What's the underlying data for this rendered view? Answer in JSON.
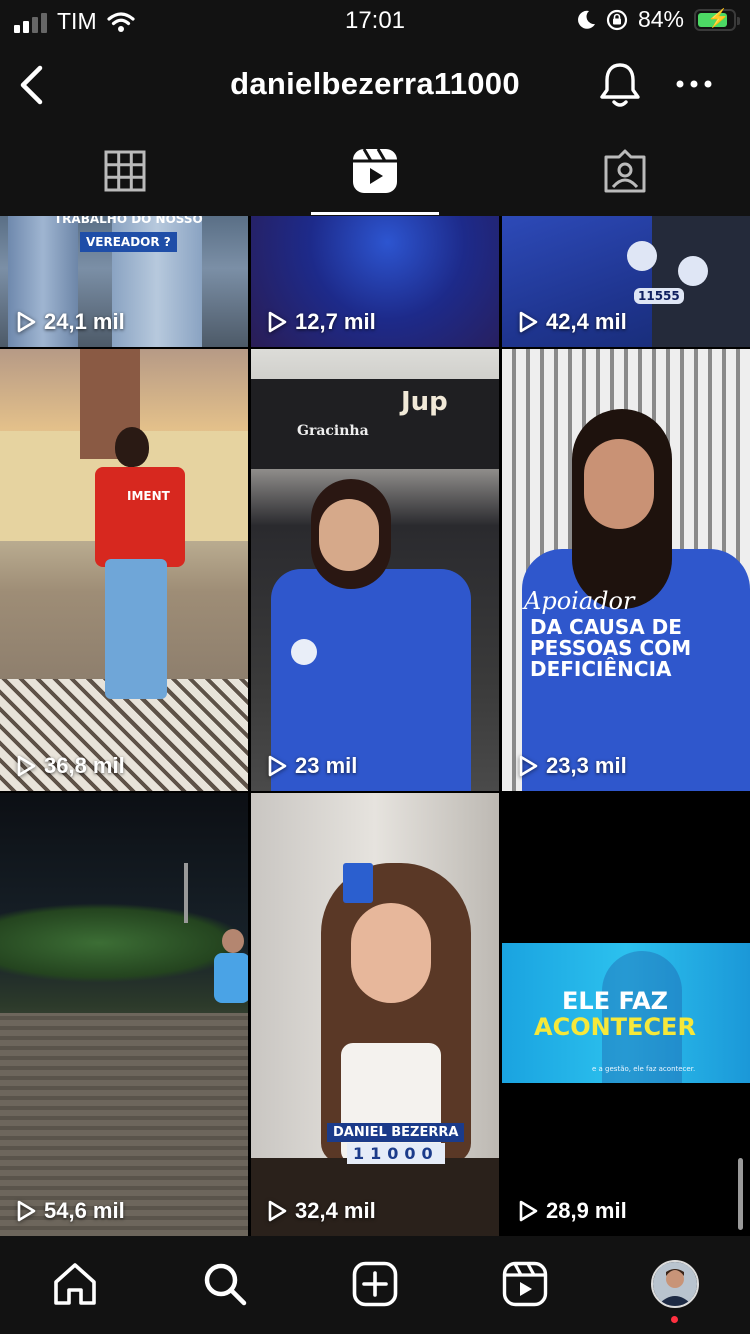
{
  "status_bar": {
    "carrier": "TIM",
    "time": "17:01",
    "battery_percent": "84%",
    "battery_level": 0.84
  },
  "header": {
    "username": "danielbezerra11000"
  },
  "tabs": [
    {
      "name": "grid",
      "active": false
    },
    {
      "name": "reels",
      "active": true
    },
    {
      "name": "tagged",
      "active": false
    }
  ],
  "reels": [
    {
      "views": "24,1 mil",
      "overlay": [
        "TRABALHO DO NOSSO",
        "VEREADOR ?"
      ]
    },
    {
      "views": "12,7 mil"
    },
    {
      "views": "42,4 mil",
      "overlay": [
        "11555"
      ]
    },
    {
      "views": "36,8 mil",
      "overlay": [
        "IMENT"
      ]
    },
    {
      "views": "23 mil",
      "overlay": [
        "Gracinha",
        "Jup"
      ]
    },
    {
      "views": "23,3 mil",
      "overlay": [
        "Apoiador",
        "DA CAUSA DE",
        "PESSOAS COM",
        "DEFICIÊNCIA"
      ]
    },
    {
      "views": "54,6 mil"
    },
    {
      "views": "32,4 mil",
      "overlay": [
        "DANIEL BEZERRA",
        "11000"
      ]
    },
    {
      "views": "28,9 mil",
      "overlay": [
        "ELE FAZ",
        "ACONTECER",
        "e a gestão, ele faz acontecer."
      ]
    }
  ],
  "bottom_nav": [
    "home-icon",
    "search-icon",
    "create-icon",
    "reels-icon",
    "profile-avatar"
  ],
  "colors": {
    "background": "#000000",
    "bar_background": "#121212",
    "accent_blue": "#2f5fd8",
    "notification_dot": "#ff3040",
    "battery_green": "#4cd964"
  }
}
